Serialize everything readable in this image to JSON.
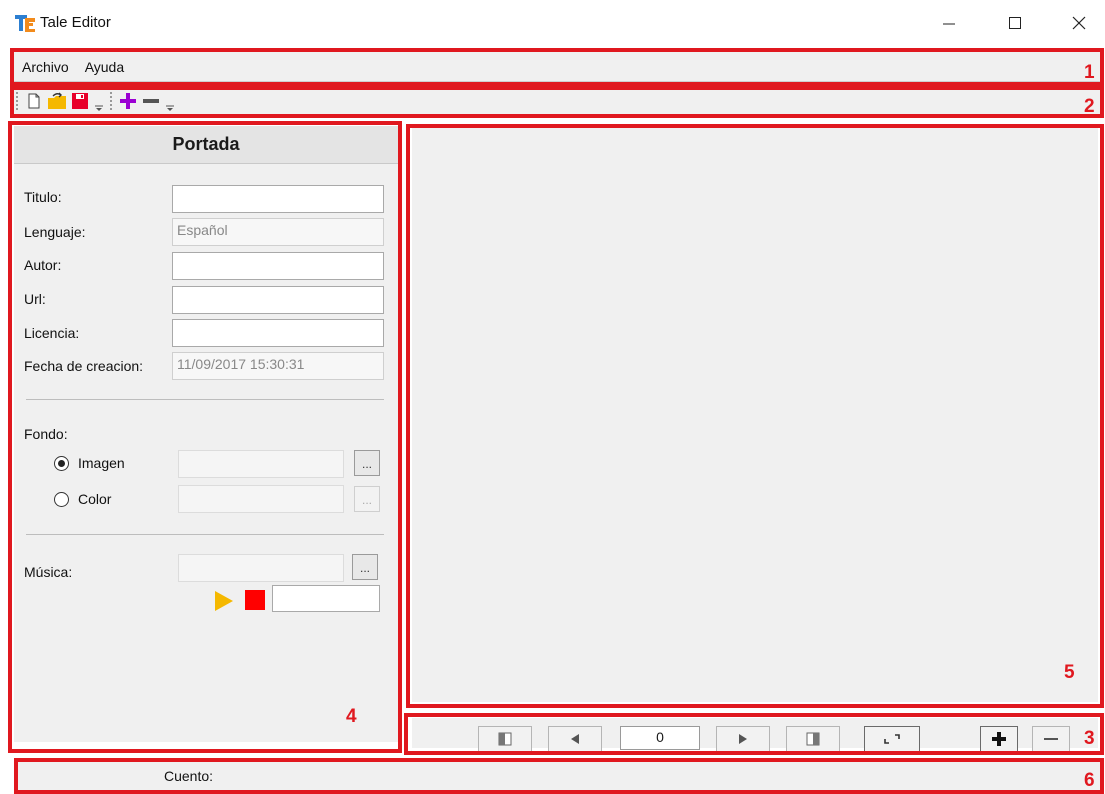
{
  "window": {
    "title": "Tale Editor",
    "app_icon_letters": "TE"
  },
  "menu": {
    "items": [
      "Archivo",
      "Ayuda"
    ]
  },
  "toolbar": {
    "icons": [
      "new-document-icon",
      "open-folder-icon",
      "save-icon",
      "add-icon",
      "remove-icon"
    ],
    "colors": {
      "open": "#f5b800",
      "save": "#e8002a",
      "add": "#9b00d3",
      "remove": "#555555"
    }
  },
  "panel": {
    "title": "Portada",
    "fields": {
      "titulo": {
        "label": "Titulo:",
        "value": ""
      },
      "lenguaje": {
        "label": "Lenguaje:",
        "value": "Español"
      },
      "autor": {
        "label": "Autor:",
        "value": ""
      },
      "url": {
        "label": "Url:",
        "value": ""
      },
      "licencia": {
        "label": "Licencia:",
        "value": ""
      },
      "fecha": {
        "label": "Fecha de creacion:",
        "value": "11/09/2017 15:30:31"
      }
    },
    "fondo": {
      "label": "Fondo:",
      "imagen": "Imagen",
      "color": "Color",
      "selected": "Imagen",
      "browse": "..."
    },
    "musica": {
      "label": "Música:",
      "browse": "..."
    }
  },
  "nav": {
    "page": "0"
  },
  "status": {
    "label": "Cuento:"
  },
  "annotations": [
    "1",
    "2",
    "3",
    "4",
    "5",
    "6"
  ],
  "colors": {
    "annotation": "#e0181f",
    "play": "#f5b800",
    "stop": "#ff0000"
  }
}
